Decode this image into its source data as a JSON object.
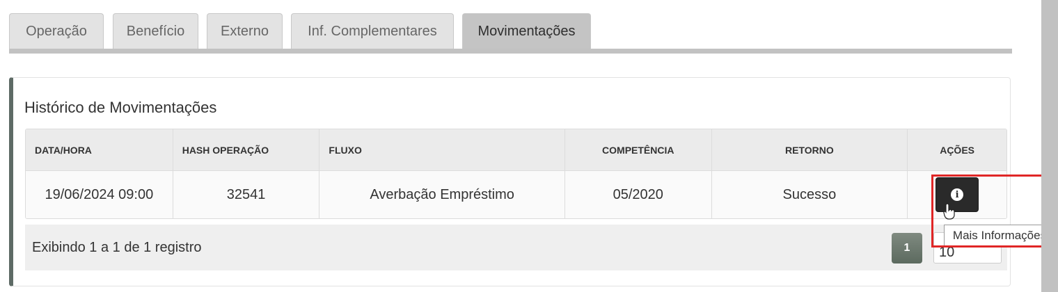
{
  "tabs": [
    {
      "label": "Operação",
      "active": false
    },
    {
      "label": "Benefício",
      "active": false
    },
    {
      "label": "Externo",
      "active": false
    },
    {
      "label": "Inf. Complementares",
      "active": false
    },
    {
      "label": "Movimentações",
      "active": true
    }
  ],
  "panel": {
    "title": "Histórico de Movimentações"
  },
  "table": {
    "columns": [
      "DATA/HORA",
      "HASH OPERAÇÃO",
      "FLUXO",
      "COMPETÊNCIA",
      "RETORNO",
      "AÇÕES"
    ],
    "rows": [
      {
        "data_hora": "19/06/2024 09:00",
        "hash": "32541",
        "fluxo": "Averbação Empréstimo",
        "competencia": "05/2020",
        "retorno": "Sucesso",
        "acao_icon": "info-icon"
      }
    ]
  },
  "footer": {
    "info_text": "Exibindo 1 a 1 de 1 registro",
    "current_page": "1",
    "page_size": "10"
  },
  "tooltip": {
    "text": "Mais Informações"
  },
  "colors": {
    "highlight": "#e02626",
    "panel_accent": "#5e6b66",
    "action_button": "#2a2a2a"
  }
}
